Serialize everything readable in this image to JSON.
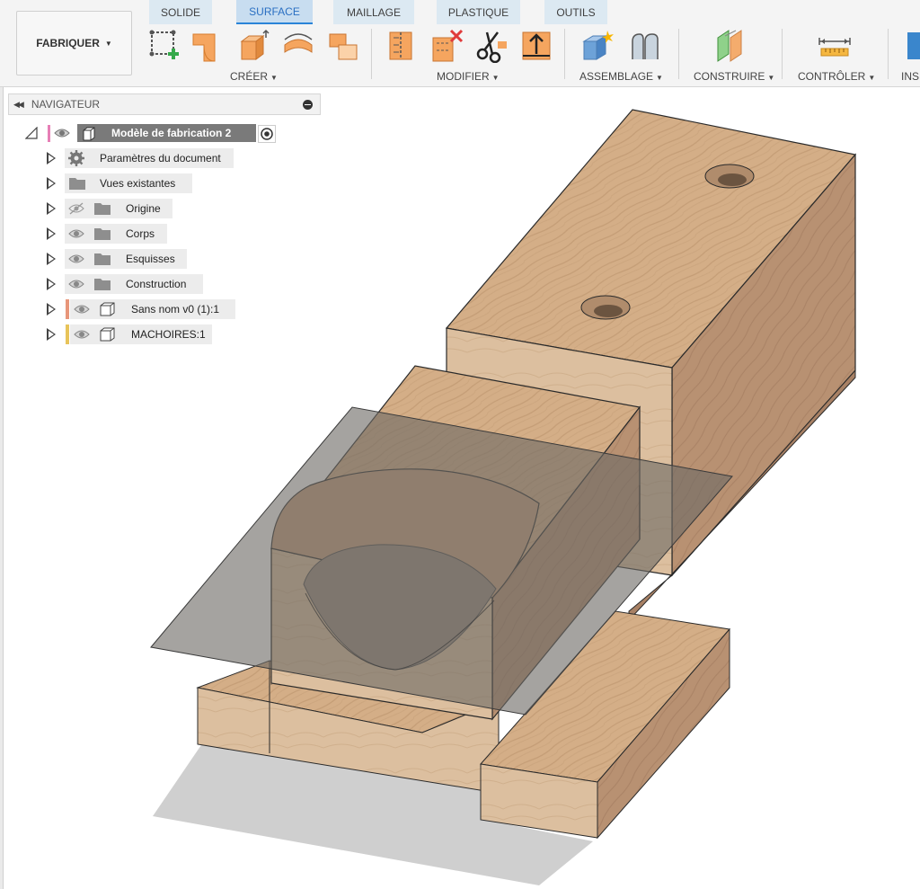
{
  "toolbar": {
    "workspace": "FABRIQUER",
    "tabs": [
      "SOLIDE",
      "SURFACE",
      "MAILLAGE",
      "PLASTIQUE",
      "OUTILS"
    ],
    "active_tab": "SURFACE",
    "groups": {
      "create": "CRÉER",
      "modify": "MODIFIER",
      "assembly": "ASSEMBLAGE",
      "construct": "CONSTRUIRE",
      "inspect": "CONTRÔLER",
      "insert": "INSÉ"
    }
  },
  "navigator": {
    "title": "NAVIGATEUR",
    "root": "Modèle de fabrication 2",
    "items": [
      {
        "label": "Paramètres du document",
        "icon": "gear-icon"
      },
      {
        "label": "Vues existantes",
        "icon": "folder-icon"
      },
      {
        "label": "Origine",
        "icon": "folder-icon",
        "visibility": "hidden"
      },
      {
        "label": "Corps",
        "icon": "folder-icon",
        "visibility": "visible"
      },
      {
        "label": "Esquisses",
        "icon": "folder-icon",
        "visibility": "visible"
      },
      {
        "label": "Construction",
        "icon": "folder-icon",
        "visibility": "visible"
      },
      {
        "label": "Sans nom v0 (1):1",
        "icon": "component-icon",
        "visibility": "visible",
        "color": "#e8967a"
      },
      {
        "label": "MACHOIRES:1",
        "icon": "component-icon",
        "visibility": "visible",
        "color": "#e8c45a"
      }
    ]
  },
  "colors": {
    "accent": "#2a84d8",
    "tool_orange": "#f5a55f",
    "wood_top": "#d4ae87",
    "wood_side": "#b89172",
    "plane": "#6e6a66"
  }
}
